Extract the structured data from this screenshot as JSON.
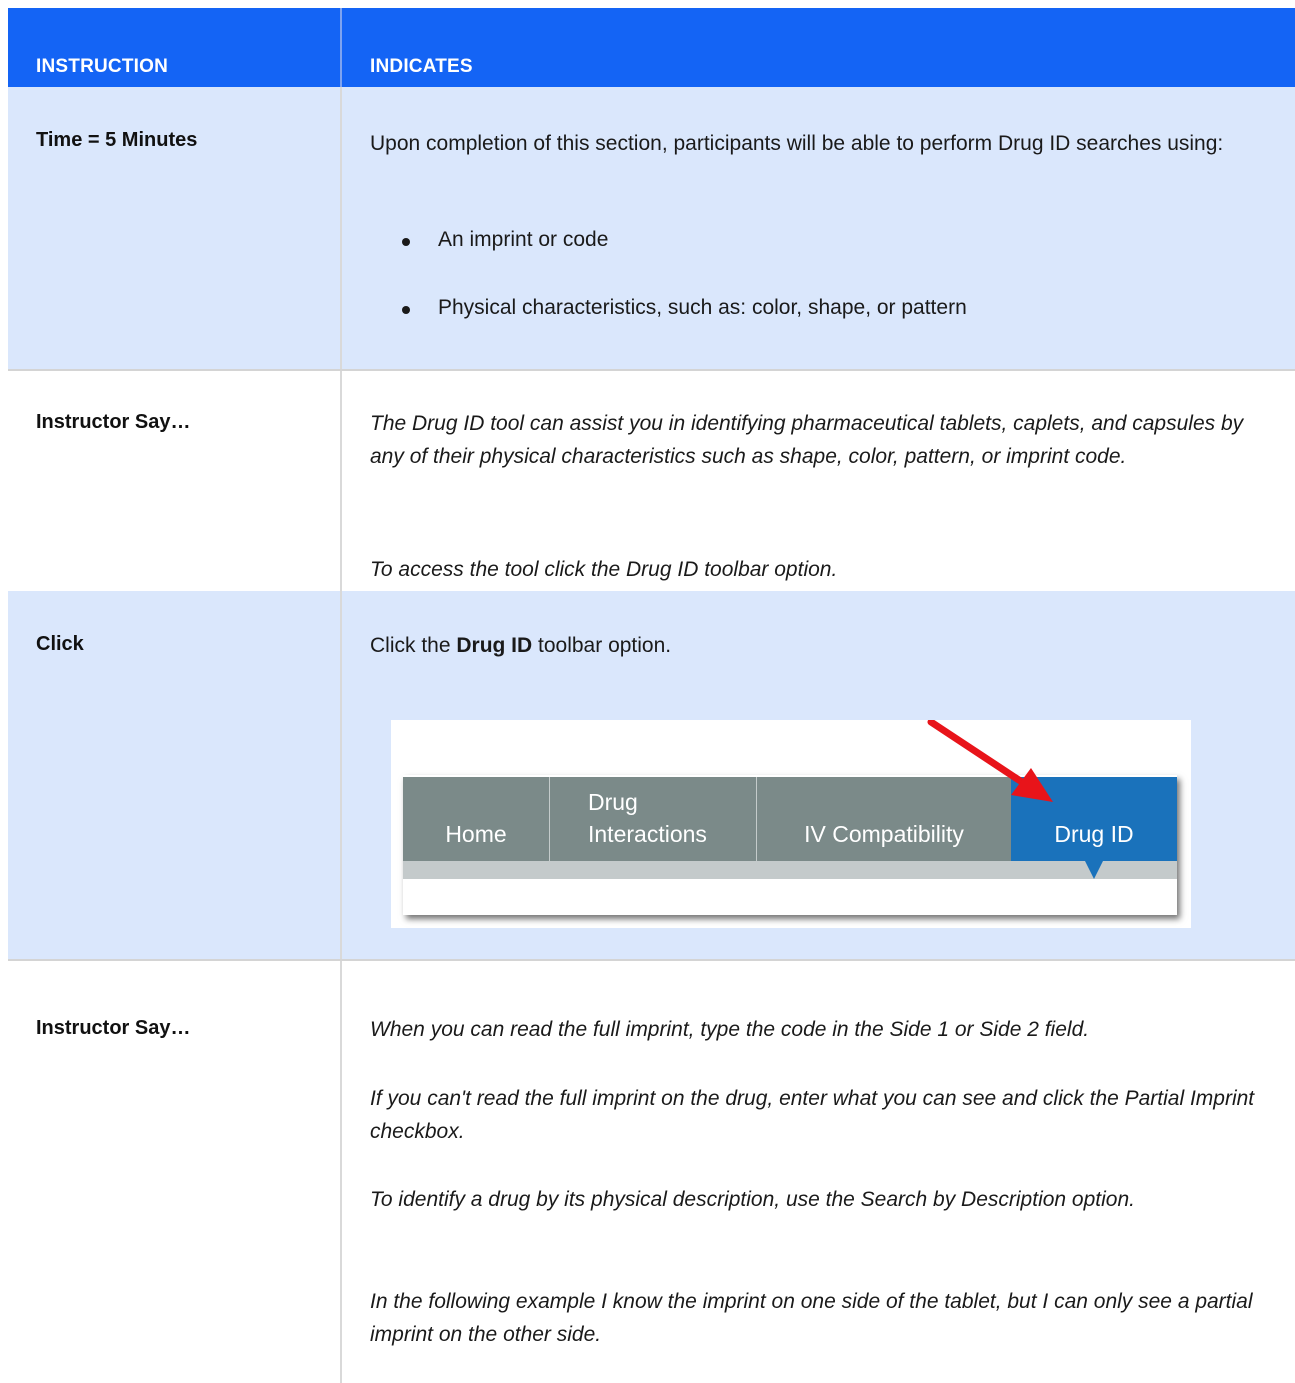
{
  "table": {
    "header": {
      "instruction": "INSTRUCTION",
      "indicates": "INDICATES"
    },
    "rows": [
      {
        "label": "Time = 5 Minutes",
        "intro": "Upon completion of this section, participants will be able to perform Drug ID searches using:",
        "bullets": [
          "An imprint or code",
          "Physical characteristics, such as: color, shape, or pattern"
        ]
      },
      {
        "label": "Instructor Say…",
        "paragraphs": [
          "The Drug ID tool can assist you in identifying pharmaceutical tablets, caplets, and capsules by any of their physical characteristics such as shape, color, pattern, or imprint code.",
          "To access the tool click the Drug ID toolbar option."
        ]
      },
      {
        "label": "Click",
        "text_before": "Click the ",
        "text_bold": "Drug ID",
        "text_after": " toolbar option.",
        "toolbar": {
          "tabs": [
            "Home",
            "Drug",
            "Interactions",
            "IV Compatibility",
            "Drug ID"
          ],
          "active_tab": "Drug ID",
          "colors": {
            "tab": "#7b8a89",
            "active": "#1a72bb",
            "arrow": "#e8141a"
          }
        }
      },
      {
        "label": "Instructor Say…",
        "paragraphs": [
          "When you can read the full imprint, type the code in the Side 1 or Side 2 field.",
          "If you can't read the full imprint on the drug, enter what you can see and click the Partial Imprint checkbox.",
          "To identify a drug by its physical description, use the Search by Description option.",
          "In the following example I know the imprint on one side of the tablet, but I can only see a partial imprint on the other side."
        ]
      }
    ]
  },
  "colors": {
    "header_bg": "#1464f5",
    "shade_bg": "#dae7fc"
  }
}
